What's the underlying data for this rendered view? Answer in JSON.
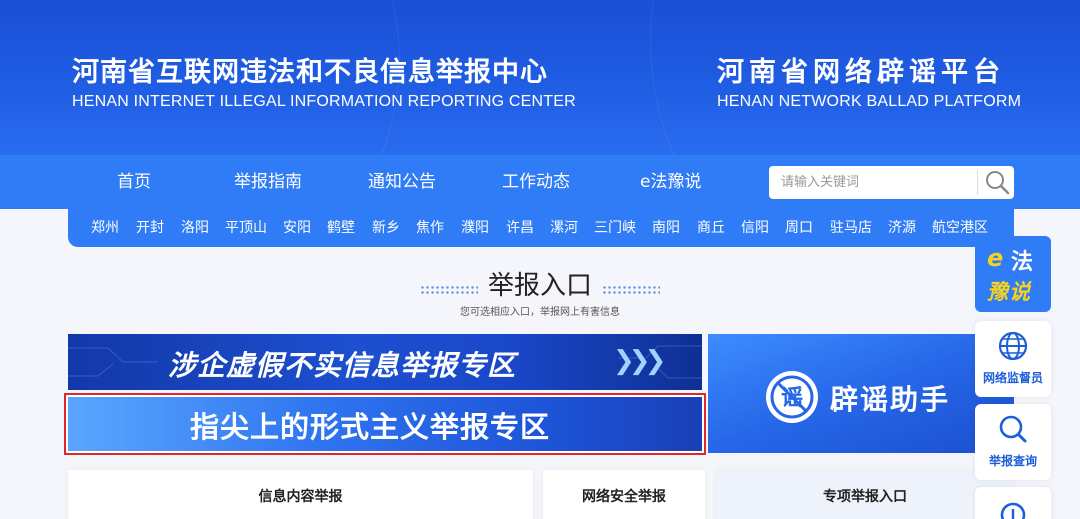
{
  "header": {
    "left_title_zh": "河南省互联网违法和不良信息举报中心",
    "left_title_en": "HENAN INTERNET ILLEGAL INFORMATION REPORTING CENTER",
    "right_title_zh": "河南省网络辟谣平台",
    "right_title_en": "HENAN NETWORK BALLAD PLATFORM"
  },
  "nav": {
    "items": [
      "首页",
      "举报指南",
      "通知公告",
      "工作动态",
      "e法豫说"
    ],
    "search_placeholder": "请输入关键词"
  },
  "cities": [
    "郑州",
    "开封",
    "洛阳",
    "平顶山",
    "安阳",
    "鹤壁",
    "新乡",
    "焦作",
    "濮阳",
    "许昌",
    "漯河",
    "三门峡",
    "南阳",
    "商丘",
    "信阳",
    "周口",
    "驻马店",
    "济源",
    "航空港区"
  ],
  "section": {
    "title": "举报入口",
    "subtitle": "您可选相应入口，举报网上有害信息"
  },
  "banners": {
    "enterprise": "涉企虚假不实信息举报专区",
    "formalism": "指尖上的形式主义举报专区",
    "rumor": "辟谣助手",
    "rumor_badge": "谣"
  },
  "cards": [
    "信息内容举报",
    "网络安全举报",
    "专项举报入口"
  ],
  "float_panel": {
    "efa_e": "e",
    "efa_fa": "法",
    "efa_yushuo": "豫说",
    "supervisor": "网络监督员",
    "query": "举报查询"
  },
  "colors": {
    "banner_blue": "#1f5de3",
    "nav_blue": "#2f7cf6",
    "highlight_red": "#e3262a",
    "accent_yellow": "#f7d21e"
  }
}
